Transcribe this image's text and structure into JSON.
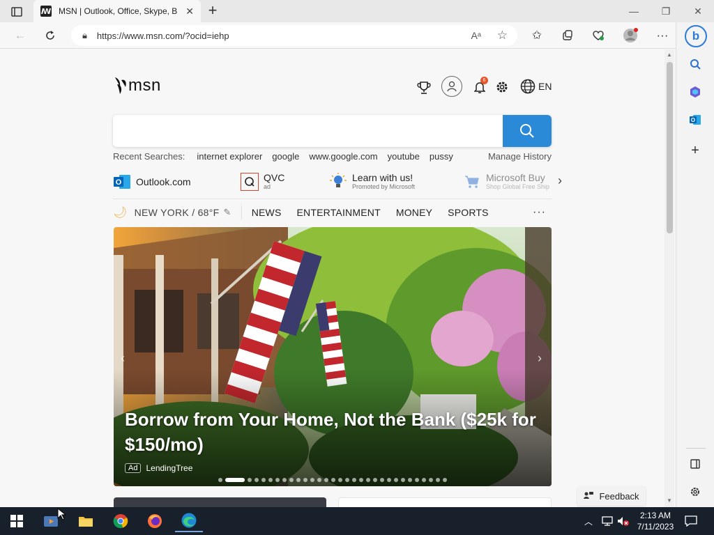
{
  "browser": {
    "tab_title": "MSN | Outlook, Office, Skype, Bing",
    "url": "https://www.msn.com/?ocid=iehp"
  },
  "header": {
    "logo_text": "msn",
    "language": "EN",
    "notification_count": "6"
  },
  "search": {
    "placeholder": "",
    "recent_label": "Recent Searches:",
    "recent_terms": [
      "internet explorer",
      "google",
      "www.google.com",
      "youtube",
      "pussy"
    ],
    "manage_history": "Manage History"
  },
  "quicklinks": [
    {
      "name": "Outlook.com",
      "sub": ""
    },
    {
      "name": "QVC",
      "sub": "ad"
    },
    {
      "name": "Learn with us!",
      "sub": "Promoted by Microsoft"
    },
    {
      "name": "Microsoft Buy",
      "sub": "Shop Global Free Ship"
    }
  ],
  "nav": {
    "weather": "NEW YORK / 68°F",
    "items": [
      "NEWS",
      "ENTERTAINMENT",
      "MONEY",
      "SPORTS"
    ],
    "more": "···"
  },
  "hero": {
    "headline": "Borrow from Your Home, Not the Bank ($25k for $150/mo)",
    "ad_tag": "Ad",
    "advertiser": "LendingTree"
  },
  "feedback": "Feedback",
  "taskbar": {
    "time": "2:13 AM",
    "date": "7/11/2023"
  },
  "colors": {
    "accent_blue": "#2a8ad8",
    "taskbar_bg": "#17202b",
    "notification_badge": "#e8542c"
  }
}
